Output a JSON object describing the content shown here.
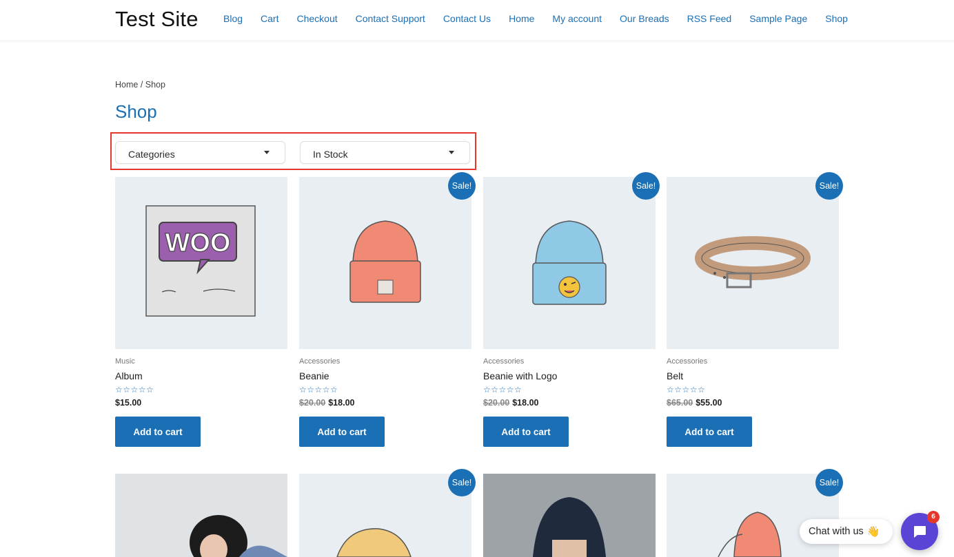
{
  "site": {
    "title": "Test Site"
  },
  "nav": {
    "items": [
      "Blog",
      "Cart",
      "Checkout",
      "Contact Support",
      "Contact Us",
      "Home",
      "My account",
      "Our Breads",
      "RSS Feed",
      "Sample Page",
      "Shop"
    ]
  },
  "breadcrumb": {
    "home": "Home",
    "separator": " / ",
    "current": "Shop"
  },
  "page": {
    "title": "Shop"
  },
  "filters": {
    "categories": {
      "selected": "Categories"
    },
    "stock": {
      "selected": "In Stock"
    }
  },
  "sale_label": "Sale!",
  "stars_glyph": "☆☆☆☆☆",
  "add_to_cart_label": "Add to cart",
  "products": [
    {
      "category": "Music",
      "name": "Album",
      "old_price": "",
      "price": "$15.00",
      "on_sale": false,
      "rating": 0
    },
    {
      "category": "Accessories",
      "name": "Beanie",
      "old_price": "$20.00",
      "price": "$18.00",
      "on_sale": true,
      "rating": 0
    },
    {
      "category": "Accessories",
      "name": "Beanie with Logo",
      "old_price": "$20.00",
      "price": "$18.00",
      "on_sale": true,
      "rating": 0
    },
    {
      "category": "Accessories",
      "name": "Belt",
      "old_price": "$65.00",
      "price": "$55.00",
      "on_sale": true,
      "rating": 0
    }
  ],
  "second_row": [
    {
      "on_sale": false
    },
    {
      "on_sale": true
    },
    {
      "on_sale": false
    },
    {
      "on_sale": true
    }
  ],
  "chat": {
    "label": "Chat with us",
    "emoji": "👋",
    "unread_count": "6"
  },
  "colors": {
    "accent": "#1a6fb5",
    "highlight": "#e5372c",
    "chat": "#5a44d6"
  }
}
